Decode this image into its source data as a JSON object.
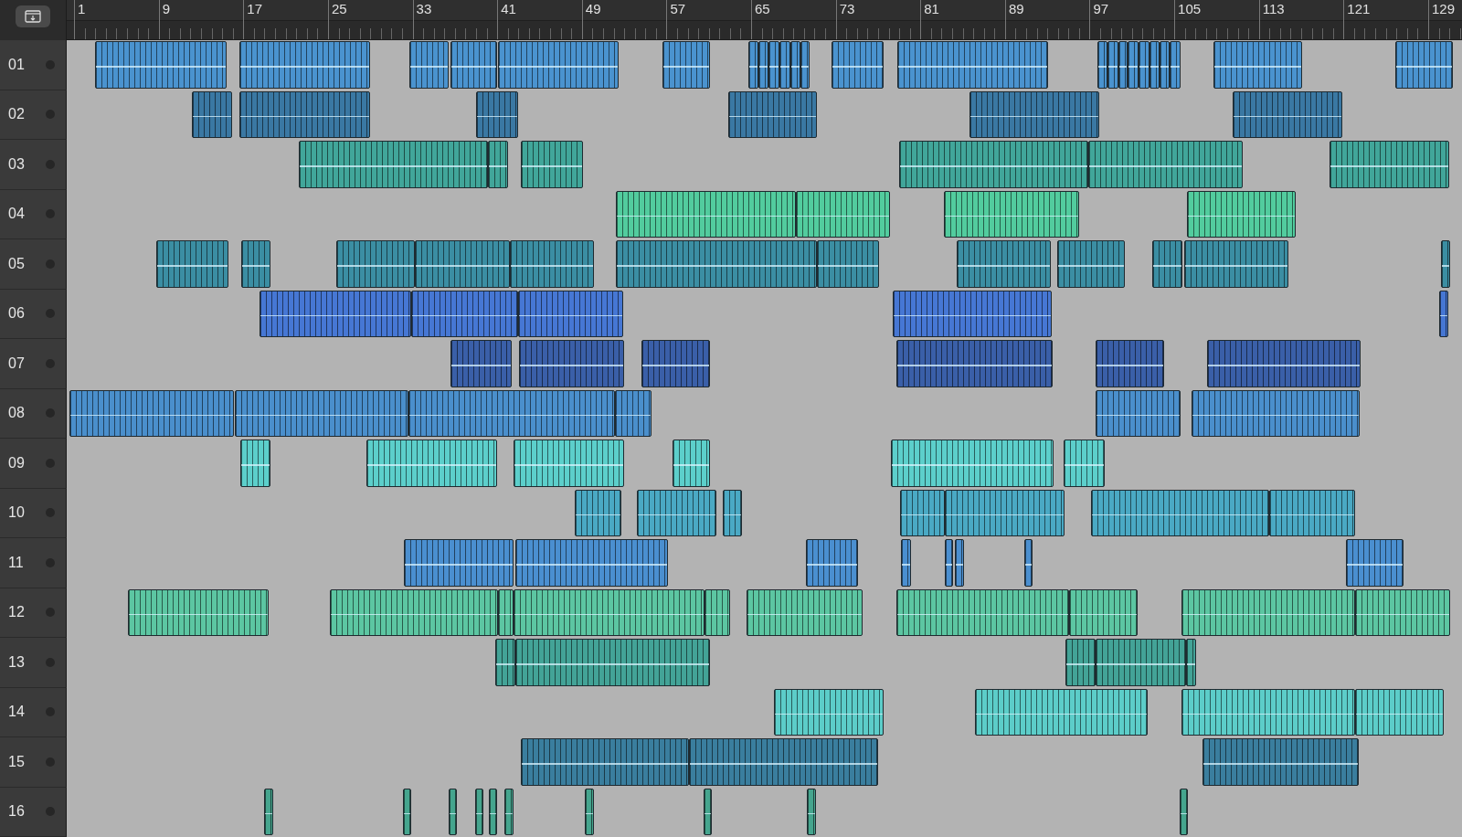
{
  "ruler": [
    "1",
    "9",
    "17",
    "25",
    "33",
    "41",
    "49",
    "57",
    "65",
    "73",
    "81",
    "89",
    "97",
    "105",
    "113",
    "121",
    "129"
  ],
  "tracks": [
    {
      "number": "01",
      "color": "#4a93cf"
    },
    {
      "number": "02",
      "color": "#3a78a3"
    },
    {
      "number": "03",
      "color": "#41a69a"
    },
    {
      "number": "04",
      "color": "#52cc9e"
    },
    {
      "number": "05",
      "color": "#3b8ea3"
    },
    {
      "number": "06",
      "color": "#4677d4"
    },
    {
      "number": "07",
      "color": "#3a5fa8"
    },
    {
      "number": "08",
      "color": "#4a8fcc"
    },
    {
      "number": "09",
      "color": "#5ccfcb"
    },
    {
      "number": "10",
      "color": "#4aa9c4"
    },
    {
      "number": "11",
      "color": "#4a8fd0"
    },
    {
      "number": "12",
      "color": "#5cc6a2"
    },
    {
      "number": "13",
      "color": "#43a397"
    },
    {
      "number": "14",
      "color": "#5ccdc9"
    },
    {
      "number": "15",
      "color": "#3a7e9e"
    },
    {
      "number": "16",
      "color": "#45a58e"
    }
  ]
}
